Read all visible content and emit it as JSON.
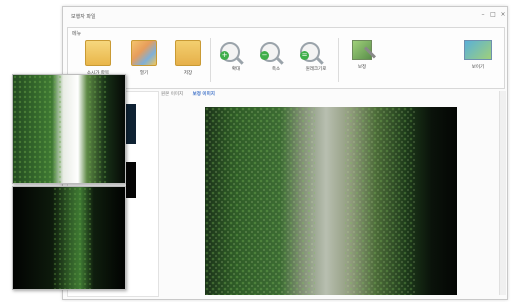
{
  "window": {
    "title": "보행자 파일",
    "controls": {
      "minimize": "–",
      "maximize": "□",
      "close": "×"
    }
  },
  "ribbon": {
    "group_label": "메뉴",
    "buttons": [
      {
        "label": "소시가 항목",
        "icon": "folder-icon"
      },
      {
        "label": "열기",
        "icon": "open-image-icon"
      },
      {
        "label": "저장",
        "icon": "save-folder-icon"
      },
      {
        "label": "확대",
        "icon": "zoom-in-icon"
      },
      {
        "label": "축소",
        "icon": "zoom-out-icon"
      },
      {
        "label": "원래크기로",
        "icon": "fit-size-icon"
      },
      {
        "label": "보정",
        "icon": "correction-icon"
      },
      {
        "label": "보이기",
        "icon": "view-icon"
      }
    ]
  },
  "tabs": [
    {
      "label": "원본 이미지",
      "active": false
    },
    {
      "label": "보정 이미지",
      "active": true
    }
  ],
  "colors": {
    "accent": "#3b6fc7",
    "folder": "#f2c65a",
    "green": "#3fae4a"
  }
}
